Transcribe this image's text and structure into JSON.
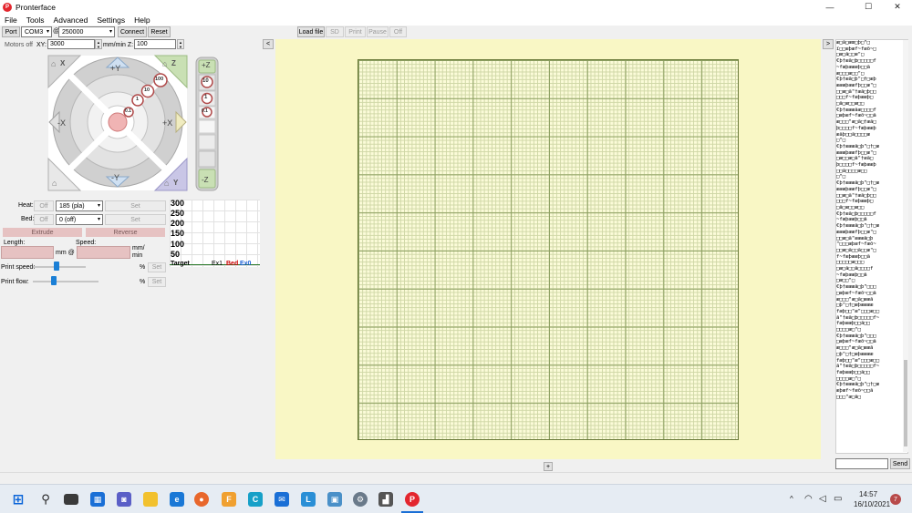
{
  "window": {
    "title": "Pronterface",
    "app_icon_glyph": "P",
    "controls": {
      "minimize": "—",
      "maximize": "☐",
      "close": "✕"
    }
  },
  "menu": [
    "File",
    "Tools",
    "Advanced",
    "Settings",
    "Help"
  ],
  "toolbar": {
    "port_label": "Port",
    "port_value": "COM3",
    "at_label": "@",
    "baud_value": "250000",
    "connect_label": "Connect",
    "reset_label": "Reset",
    "load_file_label": "Load file",
    "sd_label": "SD",
    "print_label": "Print",
    "pause_label": "Pause",
    "off_label": "Off",
    "collapse_left": "<",
    "collapse_right": ">"
  },
  "motors": {
    "motors_off_label": "Motors off",
    "xy_label": "XY:",
    "xy_value": "3000",
    "unit_label": "mm/min Z:",
    "z_value": "100"
  },
  "jog": {
    "home_x": "X",
    "home_z": "Z",
    "home_y": "Y",
    "plus_y": "+Y",
    "minus_y": "-Y",
    "plus_x": "+X",
    "minus_x": "-X",
    "step_100": "100",
    "step_10": "10",
    "step_1": "1",
    "step_01": "0.1",
    "z_plus": "+Z",
    "z_minus": "-Z",
    "z_10": "10",
    "z_1": "1",
    "z_01": "0.1"
  },
  "temps": {
    "heat_label": "Heat:",
    "heat_off": "Off",
    "heat_value": "185 (pla)",
    "heat_set": "Set",
    "bed_label": "Bed:",
    "bed_off": "Off",
    "bed_value": "0 (off)",
    "bed_set": "Set"
  },
  "extrude": {
    "extrude_label": "Extrude",
    "reverse_label": "Reverse",
    "length_label": "Length:",
    "speed_label": "Speed:",
    "mm_at": "mm @",
    "mm_min": "mm/\nmin"
  },
  "print_controls": {
    "print_speed_label": "Print speed:",
    "print_flow_label": "Print flow:",
    "percent": "%",
    "set_label": "Set",
    "print_speed_pct": 0.45,
    "print_flow_pct": 0.32
  },
  "graph": {
    "ticks": [
      "300",
      "250",
      "200",
      "150",
      "100",
      "50"
    ],
    "legend_target": "Target",
    "legend_ex1": "Ex1",
    "legend_bed": "Bed",
    "legend_ex0": "Ex0",
    "colors": {
      "ex1": "#cc0000",
      "bed": "#1a5fd6"
    }
  },
  "console": {
    "lines": [
      "æ□ã□æœ□þ□\"□",
      "ï□□æþæf~fæõ~□",
      "□æ□ã□□æ\"□",
      "€þ†æã□þ□□□□□f",
      "~fæþæææþ□□ã",
      "æ□□□æ□□\"□",
      "€þ†æã□þ\"□†□æþ",
      "æææþææfþ□□æ\"□",
      "□□æ□ã\"†æã□þ□□",
      "□□□f~fæþææþ□",
      "□ã□æ□□æ□□",
      "€þ†æææãæ□□□□f",
      "□æþæf~fæõ~□□ã",
      "æ□□□\"æ□ã□†æã□",
      "þ□□□□f~fæþææþ",
      "æãþ□□ã□□□□æ",
      "□\"□",
      "€þ†æææã□þ\"□†□æ",
      "æææþææfþ□□æ\"□",
      "□æ□□æ□ã\"†æã□",
      "þ□□□□f~fæþææþ",
      "□□ã□□□□æ□□",
      "□\"□",
      "€þ†æææã□þ\"□†□æ",
      "æææþææfþ□□æ\"□",
      "□□æ□ã\"†æã□þ□□",
      "□□□f~fæþææþ□",
      "□ã□æ□□æ□□",
      "€þ†æã□þ□□□□□f",
      "~fæþææþ□□ã",
      "€þ†æææã□þ\"□†□æ",
      "æææþææfþ□□æ\"□",
      "□□æ□ã\"æææã□þ",
      "\"□□□æþæf~fæõ~",
      "□□æ□ã□□ã□□æ\"□",
      "f~fæþææþ□□ã",
      "□□□□□æ□□□",
      "□æ□ã□□ã□□□□f",
      "~fæþææþ□□ã",
      "□æ□□\"□",
      "€þ†æææã□þ\"□□□",
      "□æþæf~fæõ~□□ã",
      "æ□□□\"æ□ã□ææã",
      "□þ\"□†□æþææææ",
      "fæþ□□\"æ\"□□□æ□□",
      "ã\"†æã□þ□□□□□f~",
      "fæþææþ□□ã□□",
      "□□□□æ□\"□",
      "€þ†æææã□þ\"□□□",
      "□æþæf~fæõ~□□ã",
      "æ□□□\"æ□ã□ææã",
      "□þ\"□†□æþææææ",
      "fæþ□□\"æ\"□□□æ□□",
      "ã\"†æã□þ□□□□□f~",
      "fæþææþ□□ã□□",
      "□□□□æ□\"□",
      "€þ†æææã□þ\"□†□æ",
      "æþæf~fæõ~□□ã",
      "□□□\"æ□ã□"
    ],
    "send_label": "Send"
  },
  "center": {
    "add_button": "+"
  },
  "taskbar": {
    "time": "14:57",
    "date": "16/10/2021",
    "notifications": "7",
    "lang_indicator": "^"
  }
}
